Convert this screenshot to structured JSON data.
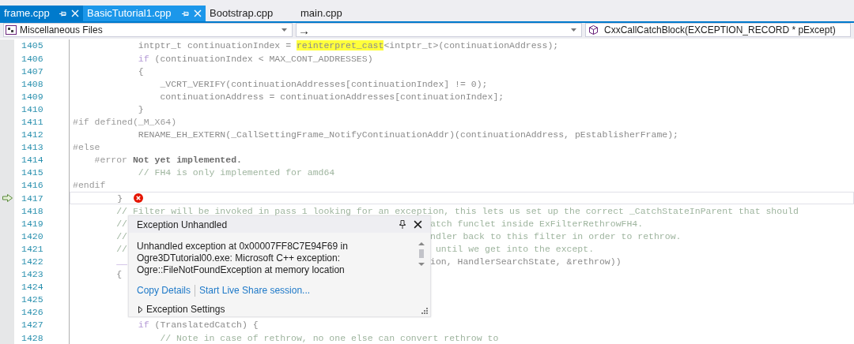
{
  "tabs": [
    {
      "label": "frame.cpp",
      "selected": true,
      "hovered": false,
      "pinned": true
    },
    {
      "label": "BasicTutorial1.cpp",
      "selected": false,
      "hovered": true,
      "pinned": true
    },
    {
      "label": "Bootstrap.cpp",
      "selected": false,
      "hovered": false,
      "pinned": false
    },
    {
      "label": "main.cpp",
      "selected": false,
      "hovered": false,
      "pinned": false
    }
  ],
  "navigation": {
    "project": "Miscellaneous Files",
    "scope": "→",
    "member": "CxxCallCatchBlock(EXCEPTION_RECORD * pExcept)"
  },
  "lines": [
    {
      "number": "1405",
      "current": false,
      "error": false,
      "tokens": [
        {
          "kind": "plain",
          "text": "            intptr_t continuationIndex = "
        },
        {
          "kind": "highlight",
          "text": "reinterpret_cast"
        },
        {
          "kind": "plain",
          "text": "<intptr_t>(continuationAddress);"
        }
      ]
    },
    {
      "number": "1406",
      "current": false,
      "error": false,
      "tokens": [
        {
          "kind": "keyword",
          "text": "            if"
        },
        {
          "kind": "plain",
          "text": " (continuationIndex < MAX_CONT_ADDRESSES)"
        }
      ]
    },
    {
      "number": "1407",
      "current": false,
      "error": false,
      "tokens": [
        {
          "kind": "plain",
          "text": "            {"
        }
      ]
    },
    {
      "number": "1408",
      "current": false,
      "error": false,
      "tokens": [
        {
          "kind": "plain",
          "text": "                _VCRT_VERIFY(continuationAddresses[continuationIndex] != 0);"
        }
      ]
    },
    {
      "number": "1409",
      "current": false,
      "error": false,
      "tokens": [
        {
          "kind": "plain",
          "text": "                continuationAddress = continuationAddresses[continuationIndex];"
        }
      ]
    },
    {
      "number": "1410",
      "current": false,
      "error": false,
      "tokens": [
        {
          "kind": "plain",
          "text": "            }"
        }
      ]
    },
    {
      "number": "1411",
      "current": false,
      "error": false,
      "tokens": [
        {
          "kind": "preproc",
          "text": "#if defined(_M_X64)"
        }
      ]
    },
    {
      "number": "1412",
      "current": false,
      "error": false,
      "tokens": [
        {
          "kind": "plain",
          "text": "            RENAME_EH_EXTERN(_CallSettingFrame_NotifyContinuationAddr)(continuationAddress, pEstablisherFrame);"
        }
      ]
    },
    {
      "number": "1413",
      "current": false,
      "error": false,
      "tokens": [
        {
          "kind": "preproc",
          "text": "#else"
        }
      ]
    },
    {
      "number": "1414",
      "current": false,
      "error": false,
      "tokens": [
        {
          "kind": "preproc",
          "text": "    #error "
        },
        {
          "kind": "bold",
          "text": "Not yet implemented."
        }
      ]
    },
    {
      "number": "1415",
      "current": false,
      "error": false,
      "tokens": [
        {
          "kind": "comment",
          "text": "            // FH4 is only implemented for amd64"
        }
      ]
    },
    {
      "number": "1416",
      "current": false,
      "error": false,
      "tokens": [
        {
          "kind": "preproc",
          "text": "#endif"
        }
      ]
    },
    {
      "number": "1417",
      "current": true,
      "error": true,
      "tokens": [
        {
          "kind": "plain",
          "text": "        }"
        }
      ]
    },
    {
      "number": "1418",
      "current": false,
      "error": false,
      "tokens": [
        {
          "kind": "comment",
          "text": "        // Filter will be invoked in pass 1 looking for an exception, this lets us set up the correct _CatchStateInParent that should"
        }
      ]
    },
    {
      "number": "1419",
      "current": false,
      "error": false,
      "tokens": [
        {
          "kind": "comment",
          "text": "        //"
        }
      ],
      "right_tokens": [
        {
          "kind": "comment",
          "text": "atch funclet inside ExFilterRethrowFH4."
        }
      ]
    },
    {
      "number": "1420",
      "current": false,
      "error": false,
      "tokens": [
        {
          "kind": "comment",
          "text": "        //"
        }
      ],
      "right_tokens": [
        {
          "kind": "comment",
          "text": "ndler back to this filter in order to rethrow."
        }
      ]
    },
    {
      "number": "1421",
      "current": false,
      "error": false,
      "tokens": [
        {
          "kind": "comment",
          "text": "        //"
        }
      ],
      "right_tokens": [
        {
          "kind": "comment",
          "text": " until we get into the except."
        }
      ]
    },
    {
      "number": "1422",
      "current": false,
      "error": false,
      "tokens": [
        {
          "kind": "keyword",
          "text": "        __"
        }
      ],
      "right_tokens": [
        {
          "kind": "plain",
          "text": "ion, HandlerSearchState, &rethrow))"
        }
      ]
    },
    {
      "number": "1423",
      "current": false,
      "error": false,
      "tokens": [
        {
          "kind": "plain",
          "text": "        {"
        }
      ]
    },
    {
      "number": "1424",
      "current": false,
      "error": false
    },
    {
      "number": "1425",
      "current": false,
      "error": false
    },
    {
      "number": "1426",
      "current": false,
      "error": false
    },
    {
      "number": "1427",
      "current": false,
      "error": false,
      "tokens": [
        {
          "kind": "keyword",
          "text": "            if"
        },
        {
          "kind": "plain",
          "text": " (TranslatedCatch) {"
        }
      ]
    },
    {
      "number": "1428",
      "current": false,
      "error": false,
      "tokens": [
        {
          "kind": "comment",
          "text": "                // Note in case of rethrow, no one else can convert rethrow to"
        }
      ]
    }
  ],
  "exception_popup": {
    "title": "Exception Unhandled",
    "message": "Unhandled exception at 0x00007FF8C7E94F69 in Ogre3DTutorial00.exe: Microsoft C++ exception: Ogre::FileNotFoundException at memory location",
    "links": [
      "Copy Details",
      "Start Live Share session..."
    ],
    "settings": {
      "label": "Exception Settings",
      "expanded": false
    }
  }
}
